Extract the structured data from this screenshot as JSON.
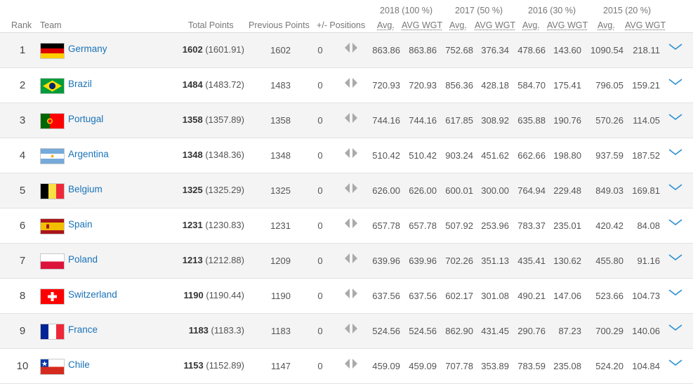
{
  "years": [
    "2018 (100 %)",
    "2017 (50 %)",
    "2016 (30 %)",
    "2015 (20 %)"
  ],
  "headers": {
    "rank": "Rank",
    "team": "Team",
    "total": "Total Points",
    "previous": "Previous Points",
    "plusminus": "+/- Positions",
    "avg": "Avg.",
    "avg_wgt": "AVG WGT"
  },
  "rows": [
    {
      "rank": "1",
      "team": "Germany",
      "flag": "germany-flag",
      "total": "1602",
      "total_precise": "(1601.91)",
      "previous": "1602",
      "pm": "0",
      "values": [
        "863.86",
        "863.86",
        "752.68",
        "376.34",
        "478.66",
        "143.60",
        "1090.54",
        "218.11"
      ]
    },
    {
      "rank": "2",
      "team": "Brazil",
      "flag": "brazil-flag",
      "total": "1484",
      "total_precise": "(1483.72)",
      "previous": "1483",
      "pm": "0",
      "values": [
        "720.93",
        "720.93",
        "856.36",
        "428.18",
        "584.70",
        "175.41",
        "796.05",
        "159.21"
      ]
    },
    {
      "rank": "3",
      "team": "Portugal",
      "flag": "portugal-flag",
      "total": "1358",
      "total_precise": "(1357.89)",
      "previous": "1358",
      "pm": "0",
      "values": [
        "744.16",
        "744.16",
        "617.85",
        "308.92",
        "635.88",
        "190.76",
        "570.26",
        "114.05"
      ]
    },
    {
      "rank": "4",
      "team": "Argentina",
      "flag": "argentina-flag",
      "total": "1348",
      "total_precise": "(1348.36)",
      "previous": "1348",
      "pm": "0",
      "values": [
        "510.42",
        "510.42",
        "903.24",
        "451.62",
        "662.66",
        "198.80",
        "937.59",
        "187.52"
      ]
    },
    {
      "rank": "5",
      "team": "Belgium",
      "flag": "belgium-flag",
      "total": "1325",
      "total_precise": "(1325.29)",
      "previous": "1325",
      "pm": "0",
      "values": [
        "626.00",
        "626.00",
        "600.01",
        "300.00",
        "764.94",
        "229.48",
        "849.03",
        "169.81"
      ]
    },
    {
      "rank": "6",
      "team": "Spain",
      "flag": "spain-flag",
      "total": "1231",
      "total_precise": "(1230.83)",
      "previous": "1231",
      "pm": "0",
      "values": [
        "657.78",
        "657.78",
        "507.92",
        "253.96",
        "783.37",
        "235.01",
        "420.42",
        "84.08"
      ]
    },
    {
      "rank": "7",
      "team": "Poland",
      "flag": "poland-flag",
      "total": "1213",
      "total_precise": "(1212.88)",
      "previous": "1209",
      "pm": "0",
      "values": [
        "639.96",
        "639.96",
        "702.26",
        "351.13",
        "435.41",
        "130.62",
        "455.80",
        "91.16"
      ]
    },
    {
      "rank": "8",
      "team": "Switzerland",
      "flag": "switzerland-flag",
      "total": "1190",
      "total_precise": "(1190.44)",
      "previous": "1190",
      "pm": "0",
      "values": [
        "637.56",
        "637.56",
        "602.17",
        "301.08",
        "490.21",
        "147.06",
        "523.66",
        "104.73"
      ]
    },
    {
      "rank": "9",
      "team": "France",
      "flag": "france-flag",
      "total": "1183",
      "total_precise": "(1183.3)",
      "previous": "1183",
      "pm": "0",
      "values": [
        "524.56",
        "524.56",
        "862.90",
        "431.45",
        "290.76",
        "87.23",
        "700.29",
        "140.06"
      ]
    },
    {
      "rank": "10",
      "team": "Chile",
      "flag": "chile-flag",
      "total": "1153",
      "total_precise": "(1152.89)",
      "previous": "1147",
      "pm": "0",
      "values": [
        "459.09",
        "459.09",
        "707.78",
        "353.89",
        "783.59",
        "235.08",
        "524.20",
        "104.84"
      ]
    }
  ],
  "colors": {
    "link": "#1a73b8",
    "row_alt_bg": "#f4f4f4",
    "chevron": "#2a8fd4",
    "position_arrows": "#aaaaaa"
  }
}
